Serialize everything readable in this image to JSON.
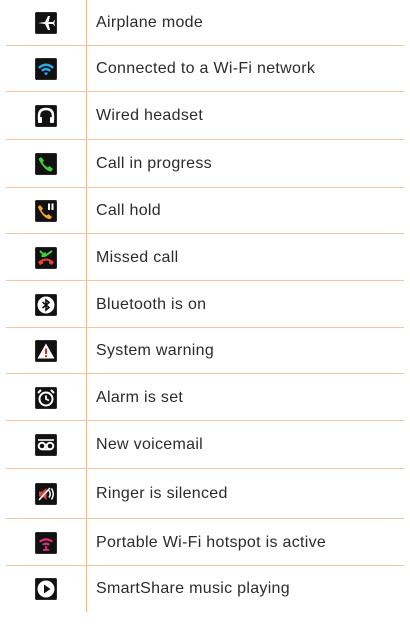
{
  "rows": [
    {
      "icon": "airplane-icon",
      "label": "Airplane mode"
    },
    {
      "icon": "wifi-connected-icon",
      "label": "Connected to a Wi-Fi network"
    },
    {
      "icon": "headset-icon",
      "label": "Wired headset"
    },
    {
      "icon": "call-in-progress-icon",
      "label": "Call in progress"
    },
    {
      "icon": "call-hold-icon",
      "label": "Call hold"
    },
    {
      "icon": "missed-call-icon",
      "label": "Missed call"
    },
    {
      "icon": "bluetooth-icon",
      "label": "Bluetooth is on"
    },
    {
      "icon": "warning-icon",
      "label": "System warning"
    },
    {
      "icon": "alarm-icon",
      "label": "Alarm is set"
    },
    {
      "icon": "voicemail-icon",
      "label": "New voicemail"
    },
    {
      "icon": "ringer-silenced-icon",
      "label": "Ringer is silenced"
    },
    {
      "icon": "hotspot-icon",
      "label": "Portable Wi-Fi hotspot is active"
    },
    {
      "icon": "play-icon",
      "label": "SmartShare music playing"
    }
  ],
  "colors": {
    "divider": "#f3c7a6",
    "wifi": "#2fa8e0",
    "call_green": "#3fcf3f",
    "call_hold_orange": "#f5a623",
    "missed_red": "#e0413a",
    "warning_red": "#d22b2b",
    "hotspot_pink": "#e0307a"
  }
}
